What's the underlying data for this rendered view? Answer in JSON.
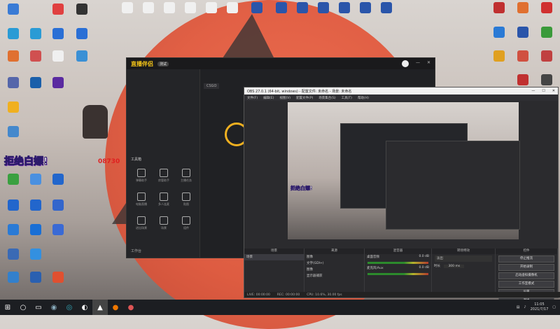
{
  "desktop": {
    "overlay_lines": [
      "拒绝白嫖!",
      "08730"
    ]
  },
  "assistant": {
    "app_name": "直播伴侣",
    "version_badge": "测试",
    "tab_hint": "CS:GO",
    "left_tools_label": "工具箱",
    "tools": [
      "弹幕助手",
      "房管助手",
      "主播任务",
      "电脑直播",
      "多人连麦",
      "贴图",
      "进出场景",
      "场景",
      "组件"
    ],
    "bottom_hint": "工作台",
    "stream_title": "CSGO"
  },
  "obs": {
    "title": "OBS 27.0.1 (64-bit, windows) - 配置文件: 未命名 - 场景: 未命名",
    "menu": [
      "文件(F)",
      "编辑(E)",
      "视图(V)",
      "配置文件(P)",
      "场景集合(S)",
      "工具(T)",
      "帮助(H)"
    ],
    "docks": {
      "scenes_header": "场景",
      "sources_header": "来源",
      "mixer_header": "混音器",
      "transitions_header": "转场特效",
      "controls_header": "控件"
    },
    "scenes": [
      "场景"
    ],
    "sources": [
      "图像",
      "文字(GDI+)",
      "图像",
      "显示器捕获"
    ],
    "mixer": [
      {
        "name": "桌面音频",
        "db": "0.0 dB"
      },
      {
        "name": "麦克风/Aux",
        "db": "0.0 dB"
      }
    ],
    "transition": {
      "type": "淡出",
      "duration_label": "时长",
      "duration": "300 ms"
    },
    "controls": [
      "停止推流",
      "开始录制",
      "启动虚拟摄像机",
      "工作室模式",
      "设置",
      "退出"
    ],
    "status": {
      "live": "LIVE: 00:00:00",
      "rec": "REC: 00:00:00",
      "cpu": "CPU: 10.6%, 30.00 fps"
    }
  },
  "taskbar": {
    "time": "11:05",
    "date": "2021/7/17"
  }
}
